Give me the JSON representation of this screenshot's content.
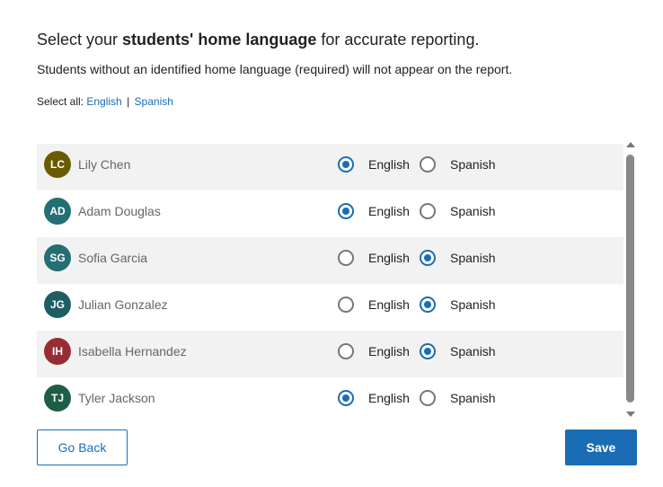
{
  "header": {
    "title_prefix": "Select your ",
    "title_bold": "students' home language",
    "title_suffix": " for accurate reporting.",
    "subtitle": "Students without an identified home language (required) will not appear on the report."
  },
  "select_all": {
    "label": "Select all:",
    "english": "English",
    "separator": "|",
    "spanish": "Spanish"
  },
  "options": {
    "english": "English",
    "spanish": "Spanish"
  },
  "students": [
    {
      "initials": "LC",
      "name": "Lily Chen",
      "avatar_color": "#6b5b00",
      "language": "English"
    },
    {
      "initials": "AD",
      "name": "Adam Douglas",
      "avatar_color": "#236f73",
      "language": "English"
    },
    {
      "initials": "SG",
      "name": "Sofia Garcia",
      "avatar_color": "#236f73",
      "language": "Spanish"
    },
    {
      "initials": "JG",
      "name": "Julian Gonzalez",
      "avatar_color": "#1d5e63",
      "language": "Spanish"
    },
    {
      "initials": "IH",
      "name": "Isabella Hernandez",
      "avatar_color": "#962d35",
      "language": "Spanish"
    },
    {
      "initials": "TJ",
      "name": "Tyler Jackson",
      "avatar_color": "#1e5e44",
      "language": "English"
    }
  ],
  "buttons": {
    "back": "Go Back",
    "save": "Save"
  },
  "colors": {
    "accent": "#1a6db5"
  }
}
